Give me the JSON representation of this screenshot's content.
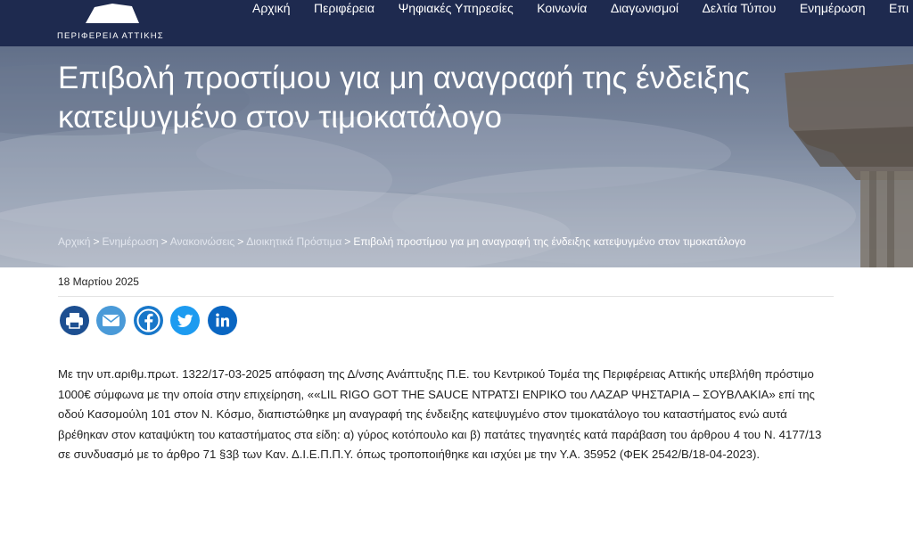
{
  "header": {
    "logo_text": "ΠΕΡΙΦΕΡΕΙΑ ΑΤΤΙΚΗΣ",
    "nav": [
      "Αρχική",
      "Περιφέρεια",
      "Ψηφιακές Υπηρεσίες",
      "Κοινωνία",
      "Διαγωνισμοί",
      "Δελτία Τύπου",
      "Ενημέρωση",
      "Επι"
    ]
  },
  "hero": {
    "title": "Επιβολή προστίμου για μη αναγραφή της ένδειξης κατεψυγμένο στον τιμοκατάλογο",
    "breadcrumb": {
      "links": [
        "Αρχική",
        "Ενημέρωση",
        "Ανακοινώσεις",
        "Διοικητικά Πρόστιμα"
      ],
      "separator": ">",
      "current": "Επιβολή προστίμου για μη αναγραφή της ένδειξης κατεψυγμένο στον τιμοκατάλογο"
    }
  },
  "article": {
    "date": "18 Μαρτίου 2025",
    "share": [
      {
        "name": "print",
        "color": "#1d4f91"
      },
      {
        "name": "email",
        "color": "#4a9ad8"
      },
      {
        "name": "facebook",
        "color": "#1877c9"
      },
      {
        "name": "twitter",
        "color": "#1d9bf0"
      },
      {
        "name": "linkedin",
        "color": "#0a66c2"
      }
    ],
    "body": "Με την υπ.αριθμ.πρωτ. 1322/17-03-2025 απόφαση της Δ/νσης Ανάπτυξης Π.Ε. του Κεντρικού Τομέα της Περιφέρειας Αττικής υπεβλήθη πρόστιμο 1000€ σύμφωνα με την οποία στην επιχείρηση,  ««LIL RIGO GOT THE SAUCE ΝΤΡΑΤΣΙ ΕΝΡΙΚΟ του ΛΑΖΑΡ ΨΗΣΤΑΡΙΑ – ΣΟΥΒΛΑΚΙΑ» επί της οδού Κασομούλη 101 στον Ν. Κόσμο, διαπιστώθηκε μη αναγραφή της ένδειξης κατεψυγμένο στον τιμοκατάλογο  του καταστήματος ενώ αυτά βρέθηκαν στον καταψύκτη του καταστήματος στα είδη: α) γύρος κοτόπουλο και β) πατάτες τηγανητές κατά παράβαση του άρθρου 4  του Ν. 4177/13 σε συνδυασμό με το άρθρο 71 §3β των Καν. Δ.Ι.Ε.Π.Π.Υ. όπως τροποποιήθηκε και ισχύει με την Υ.Α. 35952 (ΦΕΚ 2542/Β/18-04-2023)."
  }
}
